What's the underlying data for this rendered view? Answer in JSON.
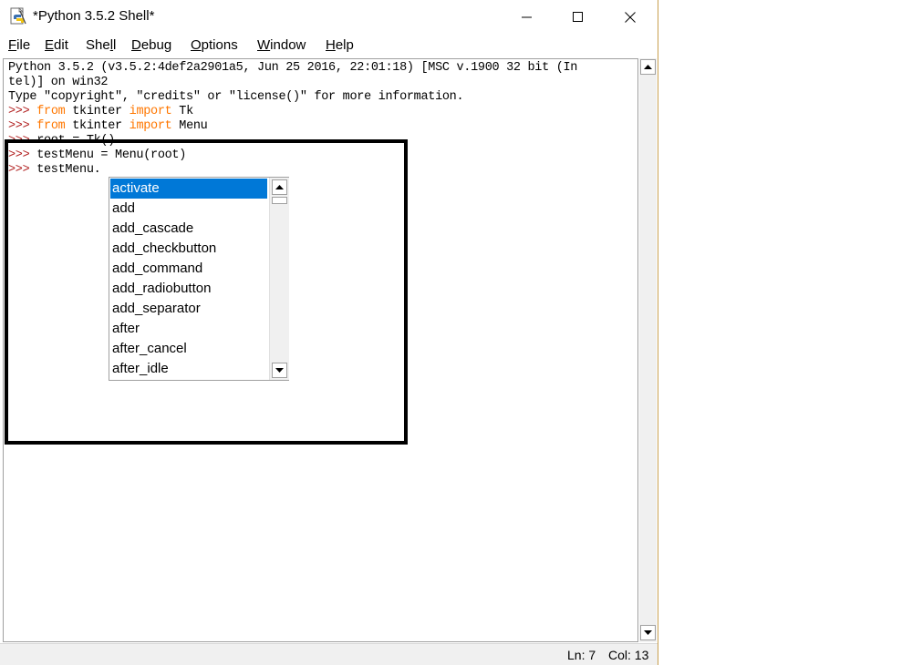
{
  "window": {
    "title": "*Python 3.5.2 Shell*",
    "icon": "python-idle-icon",
    "controls": {
      "minimize": "minimize-icon",
      "maximize": "maximize-icon",
      "close": "close-icon"
    }
  },
  "menubar": [
    {
      "mnemonic": "F",
      "rest": "ile"
    },
    {
      "mnemonic": "E",
      "rest": "dit"
    },
    {
      "pre": "She",
      "mnemonic": "l",
      "rest": "l"
    },
    {
      "mnemonic": "D",
      "rest": "ebug"
    },
    {
      "mnemonic": "O",
      "rest": "ptions"
    },
    {
      "mnemonic": "W",
      "rest": "indow"
    },
    {
      "mnemonic": "H",
      "rest": "elp"
    }
  ],
  "shell": {
    "banner1": "Python 3.5.2 (v3.5.2:4def2a2901a5, Jun 25 2016, 22:01:18) [MSC v.1900 32 bit (In",
    "banner2": "tel)] on win32",
    "banner3": "Type \"copyright\", \"credits\" or \"license()\" for more information.",
    "prompt": ">>>",
    "lines": [
      {
        "kw1": "from",
        "mid": " tkinter ",
        "kw2": "import",
        "tail": " Tk"
      },
      {
        "kw1": "from",
        "mid": " tkinter ",
        "kw2": "import",
        "tail": " Menu"
      },
      {
        "text": " root = Tk()"
      },
      {
        "text": " testMenu = Menu(root)"
      },
      {
        "text": " testMenu."
      }
    ]
  },
  "autocomplete": {
    "selected": "activate",
    "items": [
      "activate",
      "add",
      "add_cascade",
      "add_checkbutton",
      "add_command",
      "add_radiobutton",
      "add_separator",
      "after",
      "after_cancel",
      "after_idle"
    ]
  },
  "status": {
    "line": "Ln: 7",
    "col": "Col: 13"
  },
  "colors": {
    "prompt": "#b22222",
    "keyword": "#ff7700",
    "selection": "#0078d7"
  }
}
